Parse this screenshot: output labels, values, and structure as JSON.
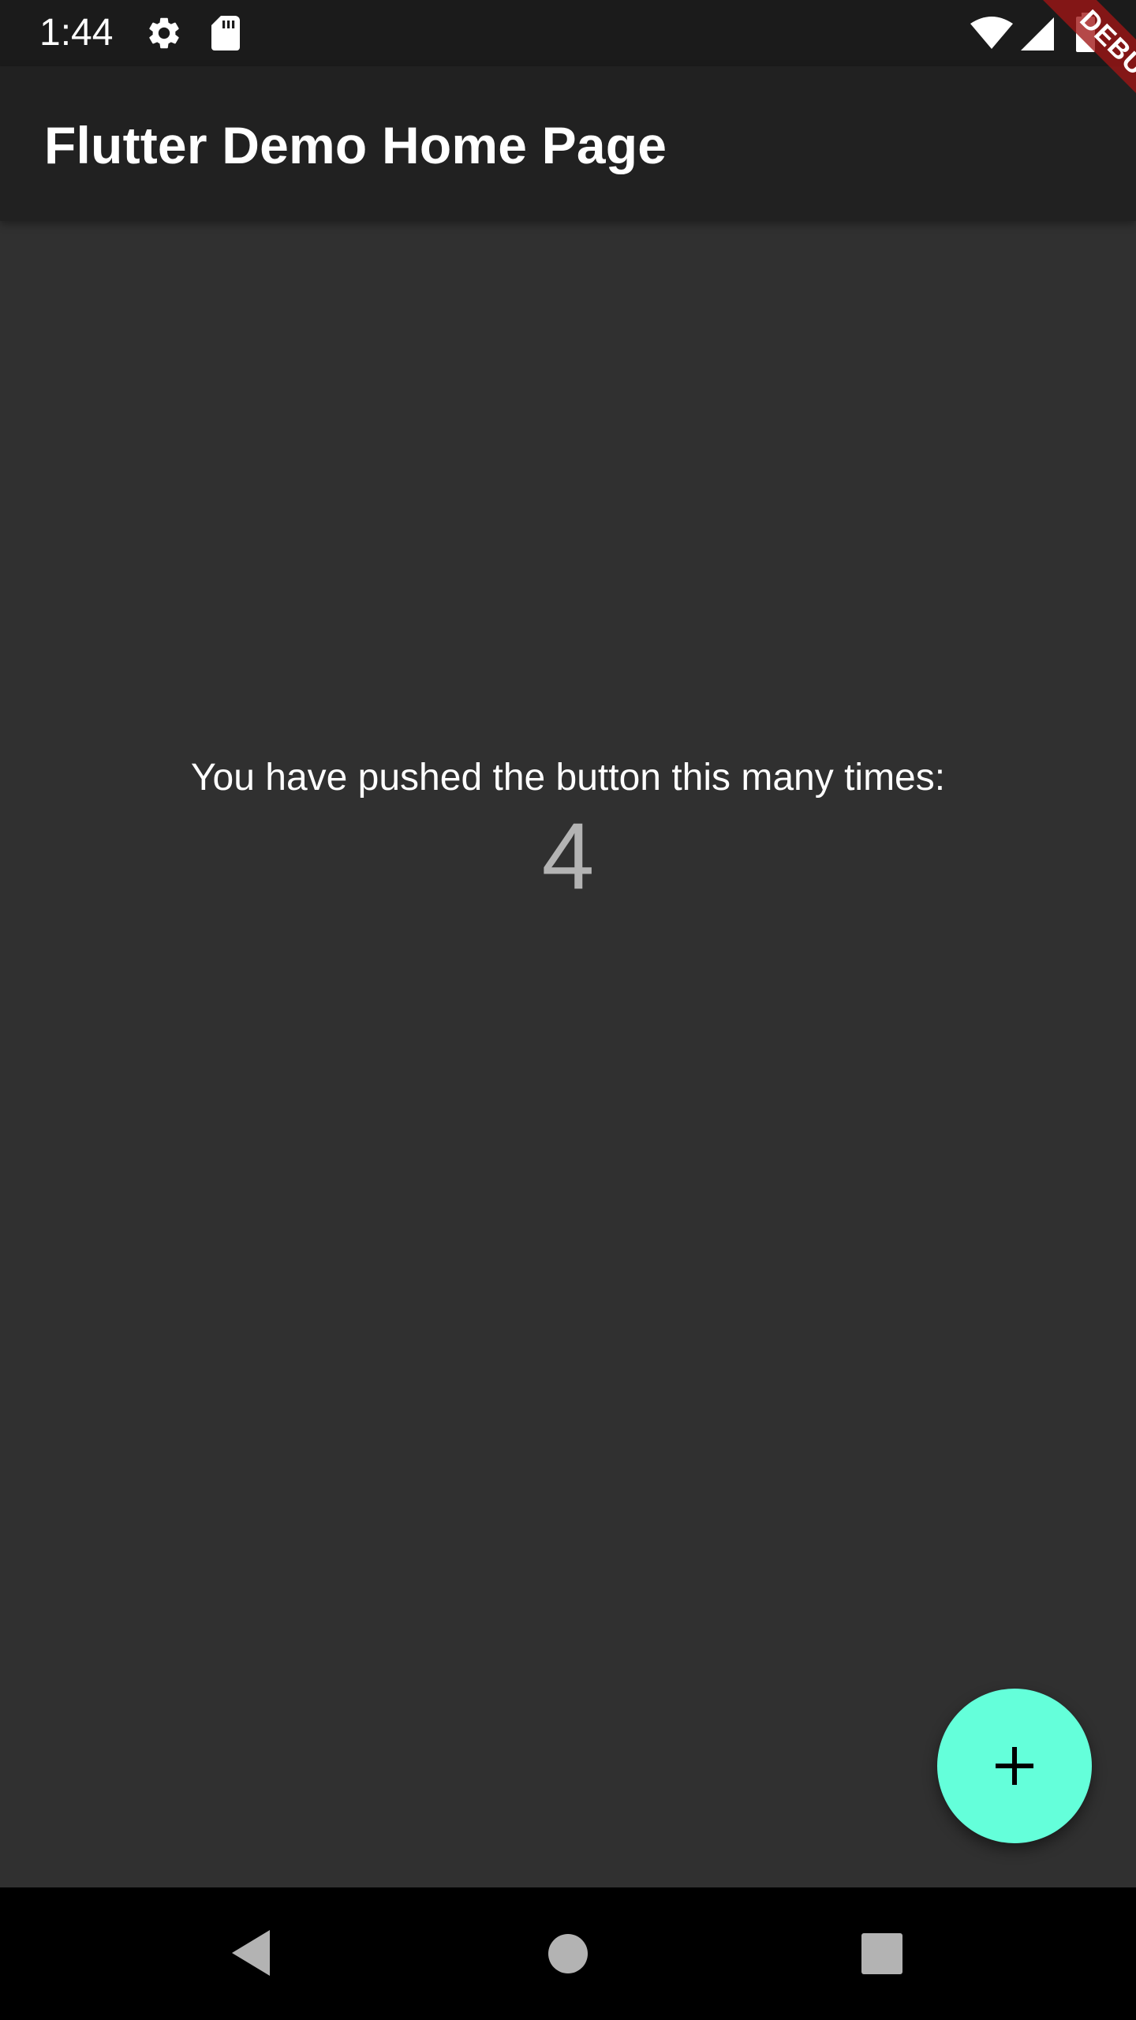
{
  "status_bar": {
    "time": "1:44",
    "icons": [
      "settings-icon",
      "sd-card-icon",
      "wifi-icon",
      "signal-icon",
      "battery-icon"
    ]
  },
  "app_bar": {
    "title": "Flutter Demo Home Page"
  },
  "debug_banner": {
    "label": "DEBUG"
  },
  "main": {
    "counter_label": "You have pushed the button this many times:",
    "counter_value": "4"
  },
  "fab": {
    "icon": "plus-icon"
  },
  "nav_bar": {
    "buttons": [
      "back-icon",
      "home-icon",
      "recents-icon"
    ]
  },
  "colors": {
    "status_bar": "#1b1b1b",
    "app_bar": "#212121",
    "background": "#303030",
    "accent": "#64ffda",
    "nav_bar": "#000000",
    "debug_banner": "#a01414"
  }
}
